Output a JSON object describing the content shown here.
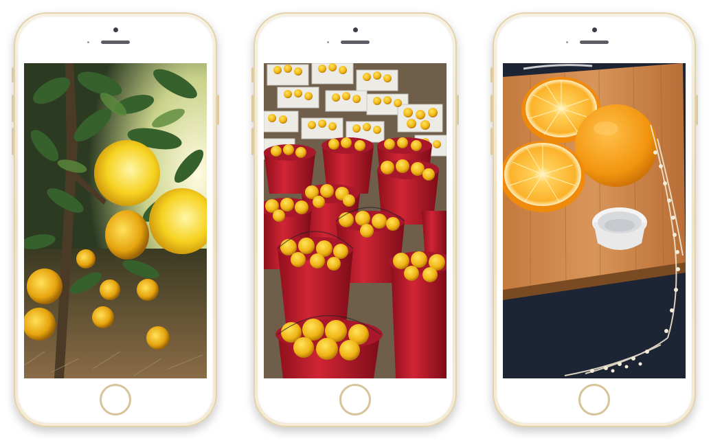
{
  "phones": [
    {
      "photo": "oranges-on-tree",
      "colors": {
        "sky": "#f7f4d6",
        "leaf": "#3d6b32",
        "fruit": "#f2c21b",
        "ground": "#6b5233"
      }
    },
    {
      "photo": "red-buckets-of-oranges",
      "colors": {
        "bucket": "#c41a2a",
        "fruit": "#f0b915",
        "crate": "#e8e6e1",
        "ground": "#7a6a55"
      }
    },
    {
      "photo": "sliced-orange-on-cutting-board",
      "colors": {
        "board": "#c9844a",
        "fruit": "#f39b16",
        "flesh": "#fbb424",
        "background": "#1d2535"
      }
    }
  ],
  "icons": {
    "home": "home-button-icon",
    "camera": "front-camera-icon",
    "speaker": "earpiece-icon"
  }
}
